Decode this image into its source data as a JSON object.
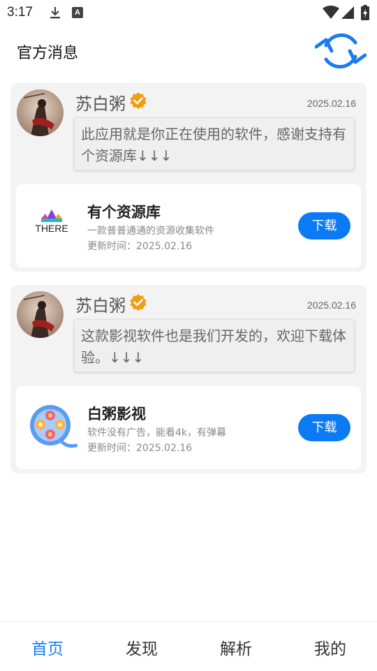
{
  "status_bar": {
    "time": "3:17",
    "keyboard_badge": "A"
  },
  "header": {
    "title": "官方消息"
  },
  "posts": [
    {
      "author": "苏白粥",
      "date": "2025.02.16",
      "message": "此应用就是你正在使用的软件，感谢支持有个资源库↓↓↓",
      "app": {
        "name": "有个资源库",
        "logo_text": "THERE",
        "description": "一款普普通通的资源收集软件",
        "updated": "更新时间：2025.02.16",
        "button": "下载"
      }
    },
    {
      "author": "苏白粥",
      "date": "2025.02.16",
      "message": "这款影视软件也是我们开发的，欢迎下载体验。↓↓↓",
      "app": {
        "name": "白粥影视",
        "description": "软件没有广告，能看4k，有弹幕",
        "updated": "更新时间：2025.02.16",
        "button": "下载"
      }
    }
  ],
  "bottom_nav": [
    {
      "label": "首页",
      "active": true
    },
    {
      "label": "发现",
      "active": false
    },
    {
      "label": "解析",
      "active": false
    },
    {
      "label": "我的",
      "active": false
    }
  ],
  "colors": {
    "accent": "#0a7af5",
    "verified": "#f39c12",
    "card_bg": "#f3f3f3"
  },
  "icons": [
    "download-icon",
    "keyboard-icon",
    "wifi-icon",
    "signal-icon",
    "battery-icon",
    "refresh-icon",
    "verified-icon",
    "there-logo",
    "film-reel-icon"
  ]
}
